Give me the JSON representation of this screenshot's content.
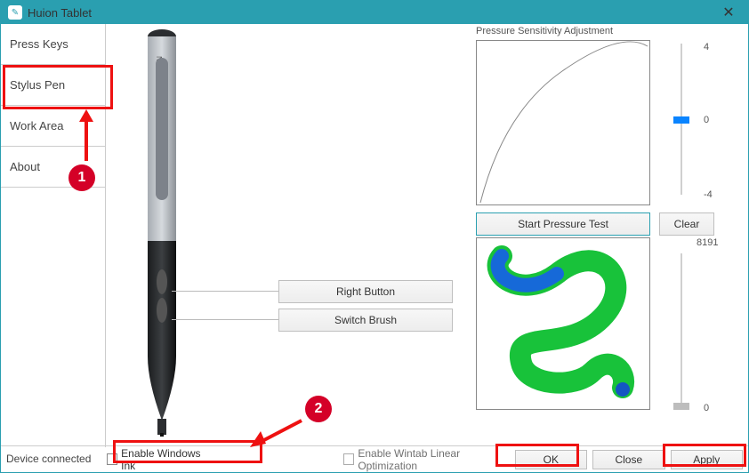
{
  "window": {
    "title": "Huion Tablet",
    "close": "✕"
  },
  "sidebar": {
    "items": [
      {
        "label": "Press Keys"
      },
      {
        "label": "Stylus Pen"
      },
      {
        "label": "Work Area"
      },
      {
        "label": "About"
      }
    ]
  },
  "pen_buttons": {
    "upper": "Right Button",
    "lower": "Switch Brush"
  },
  "pressure": {
    "heading": "Pressure Sensitivity Adjustment",
    "slider_top": "4",
    "slider_mid": "0",
    "slider_bot": "-4",
    "start_test": "Start Pressure Test",
    "clear": "Clear",
    "max_value": "8191"
  },
  "checkboxes": {
    "windows_ink": "Enable  Windows Ink",
    "wintab": "Enable Wintab Linear Optimization"
  },
  "buttons": {
    "ok": "OK",
    "close": "Close",
    "apply": "Apply"
  },
  "status": "Device connected",
  "annotations": {
    "one": "1",
    "two": "2"
  },
  "chart_data": {
    "type": "line",
    "title": "Pressure Sensitivity Adjustment",
    "xlabel": "",
    "ylabel": "",
    "xlim": [
      0,
      1
    ],
    "ylim": [
      0,
      1
    ],
    "series": [
      {
        "name": "curve",
        "x": [
          0,
          0.1,
          0.2,
          0.3,
          0.4,
          0.5,
          0.6,
          0.7,
          0.8,
          0.9,
          1.0
        ],
        "y": [
          0,
          0.28,
          0.45,
          0.58,
          0.68,
          0.76,
          0.83,
          0.89,
          0.94,
          0.97,
          1.0
        ]
      }
    ],
    "slider_range": [
      -4,
      4
    ],
    "slider_value": 0,
    "pressure_max": 8191
  }
}
